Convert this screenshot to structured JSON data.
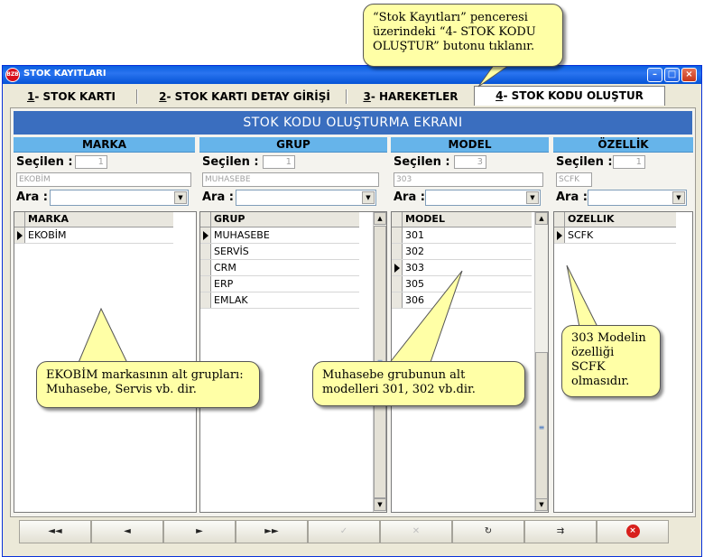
{
  "window": {
    "title": "STOK KAYITLARI",
    "icon_text": "BZB",
    "controls": {
      "minimize": "–",
      "maximize": "□",
      "close": "×"
    }
  },
  "tabs": [
    {
      "num": "1",
      "label": "- STOK KARTI"
    },
    {
      "num": "2",
      "label": "- STOK KARTI DETAY GİRİŞİ"
    },
    {
      "num": "3",
      "label": "- HAREKETLER"
    },
    {
      "num": "4",
      "label": "- STOK KODU OLUŞTUR"
    }
  ],
  "page_title": "STOK KODU OLUŞTURMA EKRANI",
  "labels": {
    "selected": "Seçilen :",
    "search": "Ara :"
  },
  "columns": {
    "marka": {
      "header": "MARKA",
      "count": "1",
      "value": "EKOBİM",
      "grid_header": "MARKA",
      "rows": [
        "EKOBİM"
      ],
      "current": 0
    },
    "grup": {
      "header": "GRUP",
      "count": "1",
      "value": "MUHASEBE",
      "grid_header": "GRUP",
      "rows": [
        "MUHASEBE",
        "SERVİS",
        "CRM",
        "ERP",
        "EMLAK"
      ],
      "current": 0
    },
    "model": {
      "header": "MODEL",
      "count": "3",
      "value": "303",
      "grid_header": "MODEL",
      "rows": [
        "301",
        "302",
        "303",
        "305",
        "306"
      ],
      "current": 2
    },
    "ozellik": {
      "header": "ÖZELLİK",
      "count": "1",
      "value": "SCFK",
      "grid_header": "OZELLIK",
      "rows": [
        "SCFK"
      ],
      "current": 0
    }
  },
  "navigator": {
    "first": "◄◄",
    "prev": "◄",
    "next": "►",
    "last": "►►",
    "post": "✓",
    "cancel": "✕",
    "refresh": "↻",
    "export": "⇉",
    "close": "×"
  },
  "callouts": {
    "top": "“Stok Kayıtları” penceresi üzerindeki  “4- STOK KODU OLUŞTUR” butonu tıklanır.",
    "marka": "EKOBİM markasının alt grupları: Muhasebe, Servis vb. dir.",
    "grup": "Muhasebe grubunun alt modelleri 301, 302 vb.dir.",
    "model": "303 Modelin özelliği SCFK olmasıdır."
  },
  "colors": {
    "titlebar": "#0a5fe0",
    "page_title_bg": "#3a6ebf",
    "column_header_bg": "#66b4ea",
    "callout_bg": "#ffffa6"
  }
}
